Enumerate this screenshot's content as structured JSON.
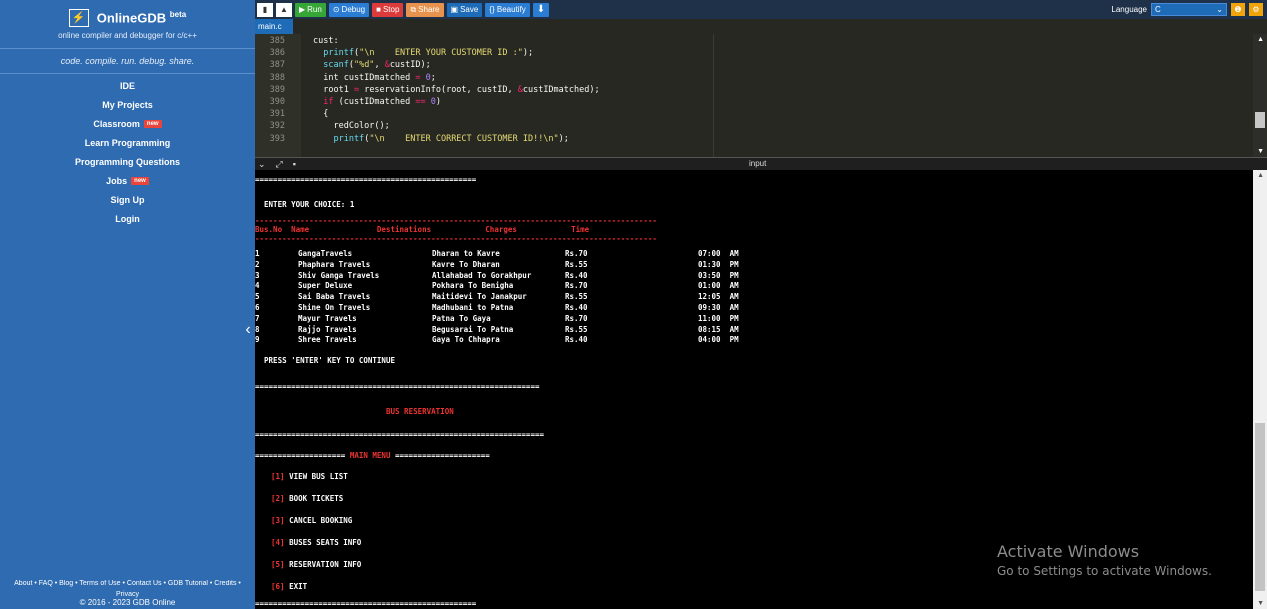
{
  "sidebar": {
    "logo": "OnlineGDB",
    "logo_sup": "beta",
    "logo_icon": "⚡",
    "subtitle": "online compiler and debugger for c/c++",
    "tagline": "code. compile. run. debug. share.",
    "nav": [
      {
        "label": "IDE"
      },
      {
        "label": "My Projects"
      },
      {
        "label": "Classroom",
        "badge": "new"
      },
      {
        "label": "Learn Programming"
      },
      {
        "label": "Programming Questions"
      },
      {
        "label": "Jobs",
        "badge": "new"
      },
      {
        "label": "Sign Up"
      },
      {
        "label": "Login"
      }
    ],
    "footer_links": "About • FAQ • Blog • Terms of Use • Contact Us • GDB Tutorial • Credits •",
    "footer_privacy": "Privacy",
    "footer_copy": "© 2016 - 2023 GDB Online",
    "collapse_glyph": "‹"
  },
  "toolbar": {
    "run": "Run",
    "debug": "Debug",
    "stop": "Stop",
    "share": "Share",
    "save": "Save",
    "beautify": "{} Beautify",
    "download_glyph": "⬇",
    "language_label": "Language",
    "language_value": "C"
  },
  "file_tab": "main.c",
  "editor": {
    "lines": [
      {
        "n": "385",
        "segments": [
          {
            "t": "cust:",
            "c": ""
          }
        ]
      },
      {
        "n": "386",
        "segments": [
          {
            "t": "  printf",
            "c": "fn"
          },
          {
            "t": "(",
            "c": ""
          },
          {
            "t": "\"\\n    ENTER YOUR CUSTOMER ID :\"",
            "c": "str"
          },
          {
            "t": ");",
            "c": ""
          }
        ]
      },
      {
        "n": "387",
        "segments": [
          {
            "t": "  scanf",
            "c": "fn"
          },
          {
            "t": "(",
            "c": ""
          },
          {
            "t": "\"%d\"",
            "c": "str"
          },
          {
            "t": ", ",
            "c": ""
          },
          {
            "t": "&",
            "c": "kw"
          },
          {
            "t": "custID);",
            "c": ""
          }
        ]
      },
      {
        "n": "388",
        "segments": [
          {
            "t": "  int custIDmatched ",
            "c": ""
          },
          {
            "t": "=",
            "c": "kw"
          },
          {
            "t": " 0",
            "c": "num"
          },
          {
            "t": ";",
            "c": ""
          }
        ]
      },
      {
        "n": "389",
        "segments": [
          {
            "t": "  root1 ",
            "c": ""
          },
          {
            "t": "=",
            "c": "kw"
          },
          {
            "t": " reservationInfo(root, custID, ",
            "c": ""
          },
          {
            "t": "&",
            "c": "kw"
          },
          {
            "t": "custIDmatched);",
            "c": ""
          }
        ]
      },
      {
        "n": "390",
        "segments": [
          {
            "t": "  if",
            "c": "kw"
          },
          {
            "t": " (custIDmatched ",
            "c": ""
          },
          {
            "t": "==",
            "c": "kw"
          },
          {
            "t": " 0",
            "c": "num"
          },
          {
            "t": ")",
            "c": ""
          }
        ]
      },
      {
        "n": "391",
        "segments": [
          {
            "t": "  {",
            "c": ""
          }
        ]
      },
      {
        "n": "392",
        "segments": [
          {
            "t": "    redColor();",
            "c": ""
          }
        ]
      },
      {
        "n": "393",
        "segments": [
          {
            "t": "    printf",
            "c": "fn"
          },
          {
            "t": "(",
            "c": ""
          },
          {
            "t": "\"\\n    ENTER CORRECT CUSTOMER ID!!\\n\"",
            "c": "str"
          },
          {
            "t": ");",
            "c": ""
          }
        ]
      }
    ]
  },
  "io": {
    "input_label": "input"
  },
  "console": {
    "rule_short": "=================================================",
    "choice_prompt": "  ENTER YOUR CHOICE: 1",
    "table_rule": "-----------------------------------------------------------------------------------------",
    "table_header": "Bus.No  Name               Destinations            Charges            Time",
    "buses": [
      {
        "no": "1",
        "name": "GangaTravels",
        "dest": "Dharan to Kavre",
        "charge": "Rs.70",
        "time": "07:00  AM"
      },
      {
        "no": "2",
        "name": "Phaphara Travels",
        "dest": "Kavre To Dharan",
        "charge": "Rs.55",
        "time": "01:30  PM"
      },
      {
        "no": "3",
        "name": "Shiv Ganga Travels",
        "dest": "Allahabad To Gorakhpur",
        "charge": "Rs.40",
        "time": "03:50  PM"
      },
      {
        "no": "4",
        "name": "Super Deluxe",
        "dest": "Pokhara To Benigha",
        "charge": "Rs.70",
        "time": "01:00  AM"
      },
      {
        "no": "5",
        "name": "Sai Baba Travels",
        "dest": "Maitidevi To Janakpur",
        "charge": "Rs.55",
        "time": "12:05  AM"
      },
      {
        "no": "6",
        "name": "Shine On Travels",
        "dest": "Madhubani to Patna",
        "charge": "Rs.40",
        "time": "09:30  AM"
      },
      {
        "no": "7",
        "name": "Mayur Travels",
        "dest": "Patna To Gaya",
        "charge": "Rs.70",
        "time": "11:00  PM"
      },
      {
        "no": "8",
        "name": "Rajjo Travels",
        "dest": "Begusarai To Patna",
        "charge": "Rs.55",
        "time": "08:15  AM"
      },
      {
        "no": "9",
        "name": "Shree Travels",
        "dest": "Gaya To Chhapra",
        "charge": "Rs.40",
        "time": "04:00  PM"
      }
    ],
    "press_enter": "  PRESS 'ENTER' KEY TO CONTINUE",
    "rule_long": "===============================================================",
    "title": "BUS RESERVATION",
    "rule_longer": "================================================================",
    "menu_left": "====================",
    "menu_title": "MAIN MENU",
    "menu_right": "=====================",
    "menu": [
      {
        "num": "[1]",
        "label": "VIEW BUS LIST"
      },
      {
        "num": "[2]",
        "label": "BOOK TICKETS"
      },
      {
        "num": "[3]",
        "label": "CANCEL BOOKING"
      },
      {
        "num": "[4]",
        "label": "BUSES SEATS INFO"
      },
      {
        "num": "[5]",
        "label": "RESERVATION INFO"
      },
      {
        "num": "[6]",
        "label": "EXIT"
      }
    ],
    "rule_bottom": "================================================="
  },
  "watermark": {
    "title": "Activate Windows",
    "subtitle": "Go to Settings to activate Windows."
  },
  "colors": {
    "sidebar": "#2f6bb0",
    "editor_bg": "#272822",
    "console_bg": "#000000",
    "console_red": "#ee3333"
  }
}
